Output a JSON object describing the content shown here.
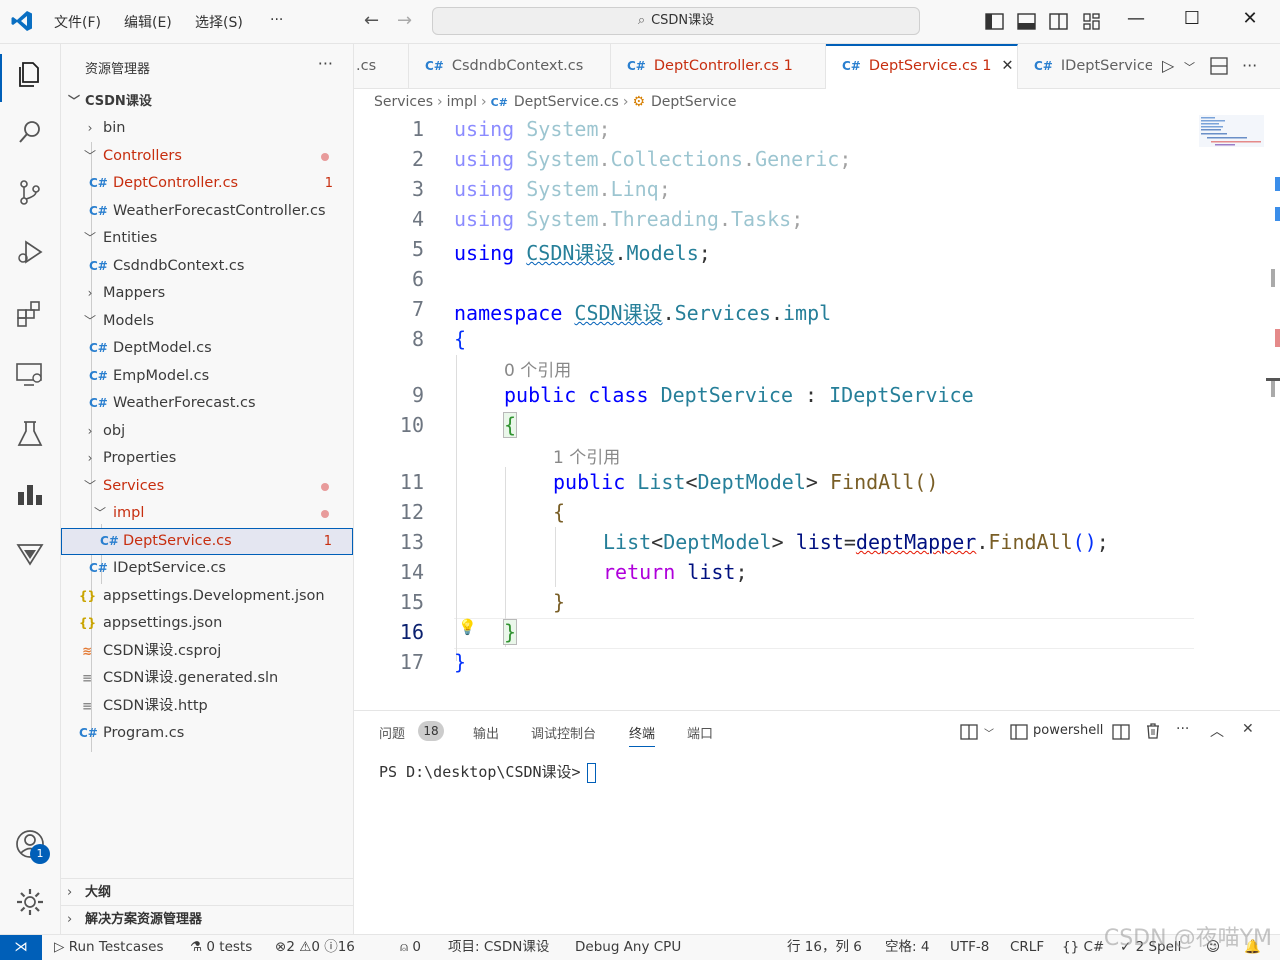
{
  "titlebar": {
    "menus": [
      "文件(F)",
      "编辑(E)",
      "选择(S)",
      "···"
    ],
    "search_text": "CSDN课设"
  },
  "sidebar": {
    "title": "资源管理器",
    "more": "···",
    "root": "CSDN课设",
    "items": [
      {
        "label": "bin"
      },
      {
        "label": "Controllers"
      },
      {
        "label": "DeptController.cs",
        "badge": "1"
      },
      {
        "label": "WeatherForecastController.cs"
      },
      {
        "label": "Entities"
      },
      {
        "label": "CsdndbContext.cs"
      },
      {
        "label": "Mappers"
      },
      {
        "label": "Models"
      },
      {
        "label": "DeptModel.cs"
      },
      {
        "label": "EmpModel.cs"
      },
      {
        "label": "WeatherForecast.cs"
      },
      {
        "label": "obj"
      },
      {
        "label": "Properties"
      },
      {
        "label": "Services"
      },
      {
        "label": "impl"
      },
      {
        "label": "DeptService.cs",
        "badge": "1"
      },
      {
        "label": "IDeptService.cs"
      },
      {
        "label": "appsettings.Development.json"
      },
      {
        "label": "appsettings.json"
      },
      {
        "label": "CSDN课设.csproj"
      },
      {
        "label": "CSDN课设.generated.sln"
      },
      {
        "label": "CSDN课设.http"
      },
      {
        "label": "Program.cs"
      }
    ],
    "outline": "大纲",
    "solution": "解决方案资源管理器"
  },
  "tabs": [
    {
      "label": ".cs"
    },
    {
      "label": "CsdndbContext.cs"
    },
    {
      "label": "DeptController.cs",
      "badge": "1"
    },
    {
      "label": "DeptService.cs",
      "badge": "1"
    },
    {
      "label": "IDeptService."
    }
  ],
  "breadcrumb": [
    "Services",
    "impl",
    "DeptService.cs",
    "DeptService"
  ],
  "editor": {
    "line_numbers": [
      "1",
      "2",
      "3",
      "4",
      "5",
      "6",
      "7",
      "8",
      "9",
      "10",
      "11",
      "12",
      "13",
      "14",
      "15",
      "16",
      "17"
    ],
    "codelens": [
      "0 个引用",
      "1 个引用"
    ],
    "tokens": {
      "using": "using",
      "system": "System",
      "collections": "Collections",
      "generic": "Generic",
      "linq": "Linq",
      "threading": "Threading",
      "tasks": "Tasks",
      "csdn": "CSDN课设",
      "models": "Models",
      "namespace": "namespace",
      "services": "Services",
      "impl": "impl",
      "public": "public",
      "class": "class",
      "deptservice": "DeptService",
      "ideptservice": "IDeptService",
      "list": "List",
      "deptmodel": "DeptModel",
      "findall": "FindAll",
      "listvar": "list",
      "deptmapper": "deptMapper",
      "return": "return"
    }
  },
  "panel": {
    "tabs": [
      "问题",
      "输出",
      "调试控制台",
      "终端",
      "端口"
    ],
    "problem_count": "18",
    "terminal_name": "powershell",
    "prompt": "PS D:\\desktop\\CSDN课设>"
  },
  "statusbar": {
    "run": "Run Testcases",
    "tests": "0 tests",
    "errors": "2",
    "warnings": "0",
    "infos": "16",
    "ports": "0",
    "project": "项目: CSDN课设",
    "config": "Debug Any CPU",
    "position": "行 16，列 6",
    "spaces": "空格: 4",
    "encoding": "UTF-8",
    "eol": "CRLF",
    "language": "C#",
    "spell": "2 Spell"
  },
  "watermark": "CSDN @夜喵YM",
  "colors": {
    "accent": "#005fb8",
    "error": "#c72e0f",
    "keyword": "#0000ff",
    "type": "#267f99"
  }
}
